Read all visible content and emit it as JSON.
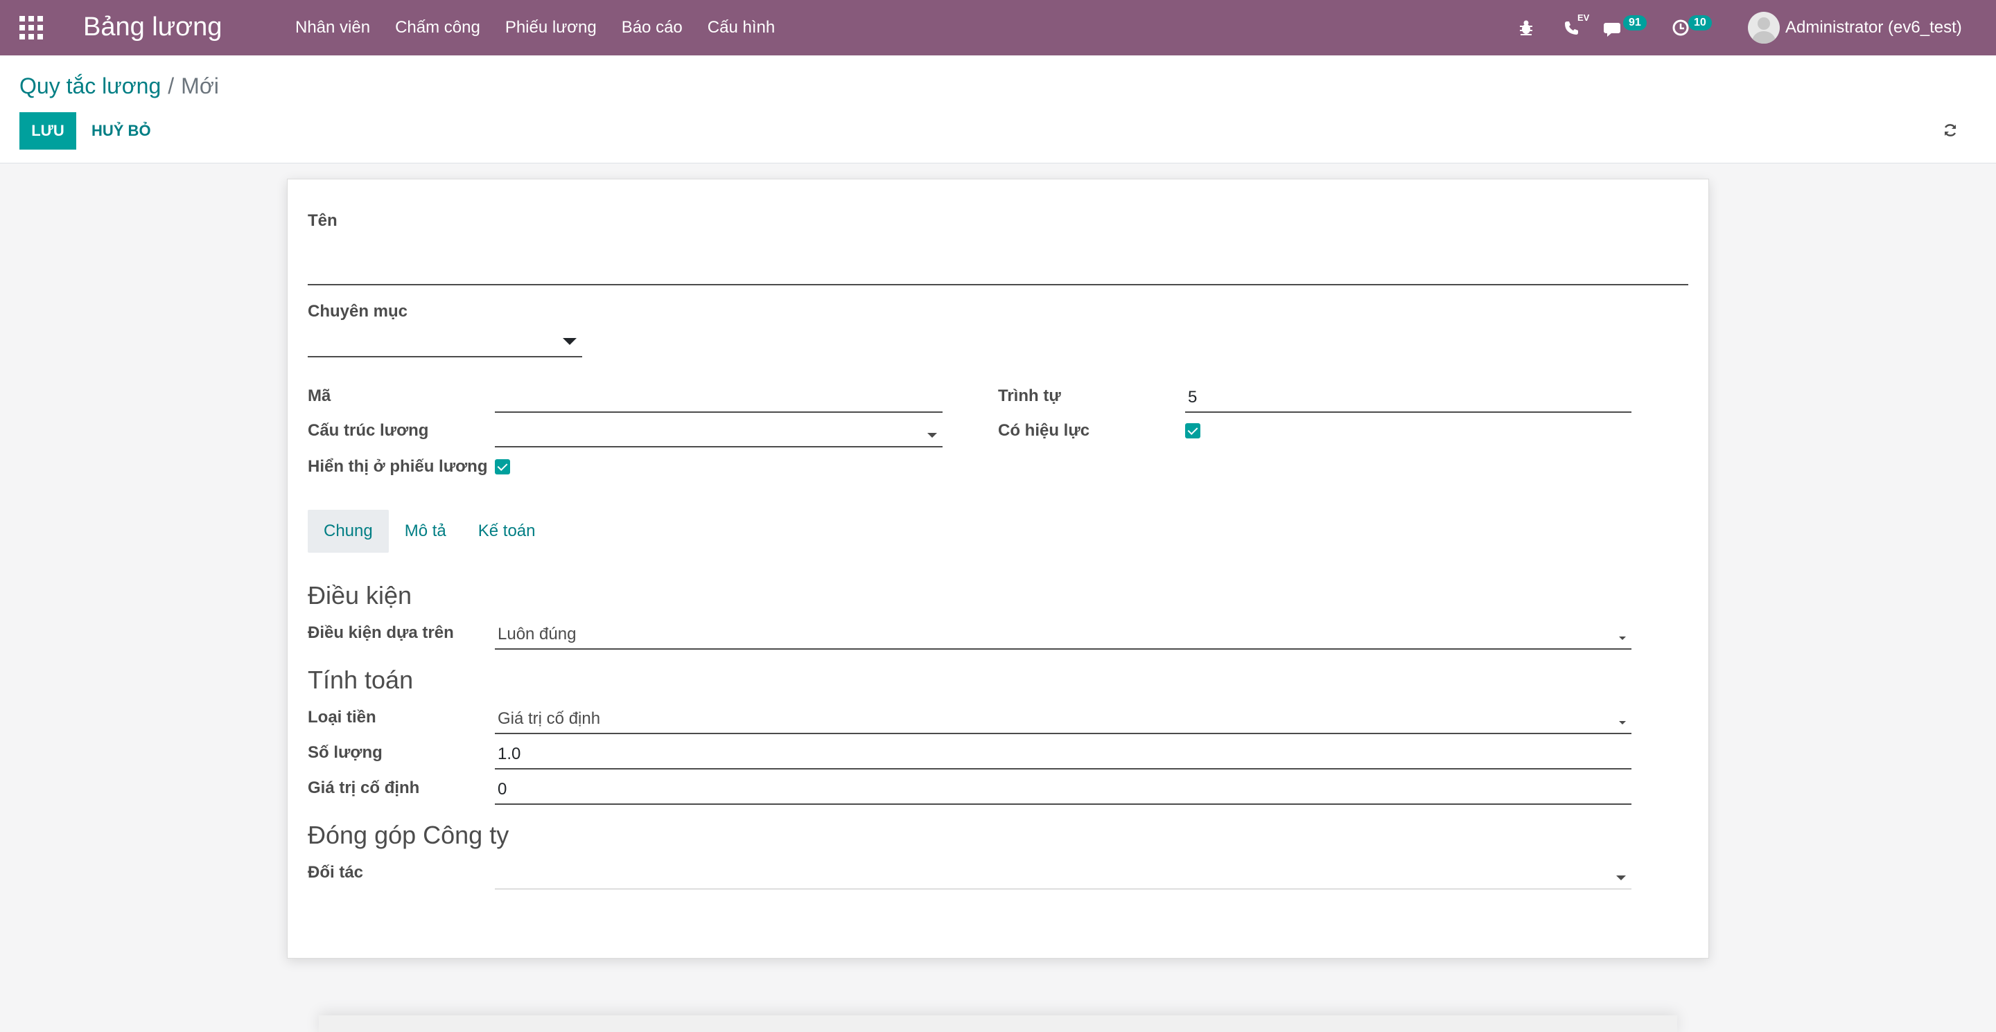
{
  "navbar": {
    "app_name": "Bảng lương",
    "menu": [
      "Nhân viên",
      "Chấm công",
      "Phiếu lương",
      "Báo cáo",
      "Cấu hình"
    ],
    "phone_label": "EV",
    "messages_count": "91",
    "activities_count": "10",
    "user_name": "Administrator (ev6_test)"
  },
  "breadcrumb": {
    "parent": "Quy tắc lương",
    "separator": "/",
    "current": "Mới"
  },
  "buttons": {
    "save": "LƯU",
    "discard": "HUỶ BỎ"
  },
  "form": {
    "name_label": "Tên",
    "name_value": "",
    "category_label": "Chuyên mục",
    "category_value": "",
    "code_label": "Mã",
    "code_value": "",
    "structure_label": "Cấu trúc lương",
    "structure_value": "",
    "show_on_payslip_label": "Hiển thị ở phiếu lương",
    "show_on_payslip": true,
    "sequence_label": "Trình tự",
    "sequence_value": "5",
    "active_label": "Có hiệu lực",
    "active": true
  },
  "tabs": [
    "Chung",
    "Mô tả",
    "Kế toán"
  ],
  "active_tab": "Chung",
  "general": {
    "conditions_title": "Điều kiện",
    "condition_based_label": "Điều kiện dựa trên",
    "condition_based_value": "Luôn đúng",
    "computation_title": "Tính toán",
    "amount_type_label": "Loại tiền",
    "amount_type_value": "Giá trị cố định",
    "quantity_label": "Số lượng",
    "quantity_value": "1.0",
    "fixed_amount_label": "Giá trị cố định",
    "fixed_amount_value": "0",
    "company_contribution_title": "Đóng góp Công ty",
    "partner_label": "Đối tác",
    "partner_value": ""
  },
  "icons": {
    "apps": "apps-grid-icon",
    "debug": "bug-icon",
    "phone": "phone-icon",
    "messages": "chat-icon",
    "activities": "clock-icon",
    "refresh": "refresh-icon"
  },
  "colors": {
    "navbar": "#875a7b",
    "primary": "#00a09d",
    "link": "#017e84"
  }
}
